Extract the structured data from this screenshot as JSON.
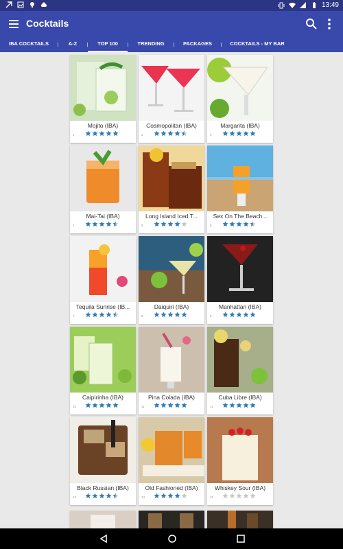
{
  "statusbar": {
    "time": "13:49"
  },
  "appbar": {
    "title": "Cocktails"
  },
  "tabs": [
    {
      "label": "IBA COCKTAILS",
      "active": false
    },
    {
      "label": "A-Z",
      "active": false
    },
    {
      "label": "TOP 100",
      "active": true
    },
    {
      "label": "TRENDING",
      "active": false
    },
    {
      "label": "PACKAGES",
      "active": false
    },
    {
      "label": "COCKTAILS - MY BAR",
      "active": false
    }
  ],
  "colors": {
    "primary": "#3949ab",
    "status": "#2c3584",
    "star": "#2f7cba",
    "star_empty": "#c7c7c7"
  },
  "cocktails": [
    {
      "name": "Mojito (IBA)",
      "rank": "1",
      "rating": 5
    },
    {
      "name": "Cosmopolitan (IBA)",
      "rank": "2",
      "rating": 4.5
    },
    {
      "name": "Margarita (IBA)",
      "rank": "3",
      "rating": 5
    },
    {
      "name": "Mai-Tai (IBA)",
      "rank": "4",
      "rating": 4.5
    },
    {
      "name": "Long Island Iced T...",
      "rank": "5",
      "rating": 4
    },
    {
      "name": "Sex On The Beach...",
      "rank": "6",
      "rating": 4.5
    },
    {
      "name": "Tequila Sunrise (IB...",
      "rank": "7",
      "rating": 4.5
    },
    {
      "name": "Daiquiri (IBA)",
      "rank": "8",
      "rating": 5
    },
    {
      "name": "Manhattan (IBA)",
      "rank": "9",
      "rating": 5
    },
    {
      "name": "Caipirinha (IBA)",
      "rank": "10",
      "rating": 5
    },
    {
      "name": "Pina Colada (IBA)",
      "rank": "11",
      "rating": 5
    },
    {
      "name": "Cuba Libre (IBA)",
      "rank": "12",
      "rating": 5
    },
    {
      "name": "Black Russian (IBA)",
      "rank": "13",
      "rating": 4.5
    },
    {
      "name": "Old Fashioned (IBA)",
      "rank": "14",
      "rating": 4
    },
    {
      "name": "Whiskey Sour (IBA)",
      "rank": "15",
      "rating": 0
    }
  ]
}
